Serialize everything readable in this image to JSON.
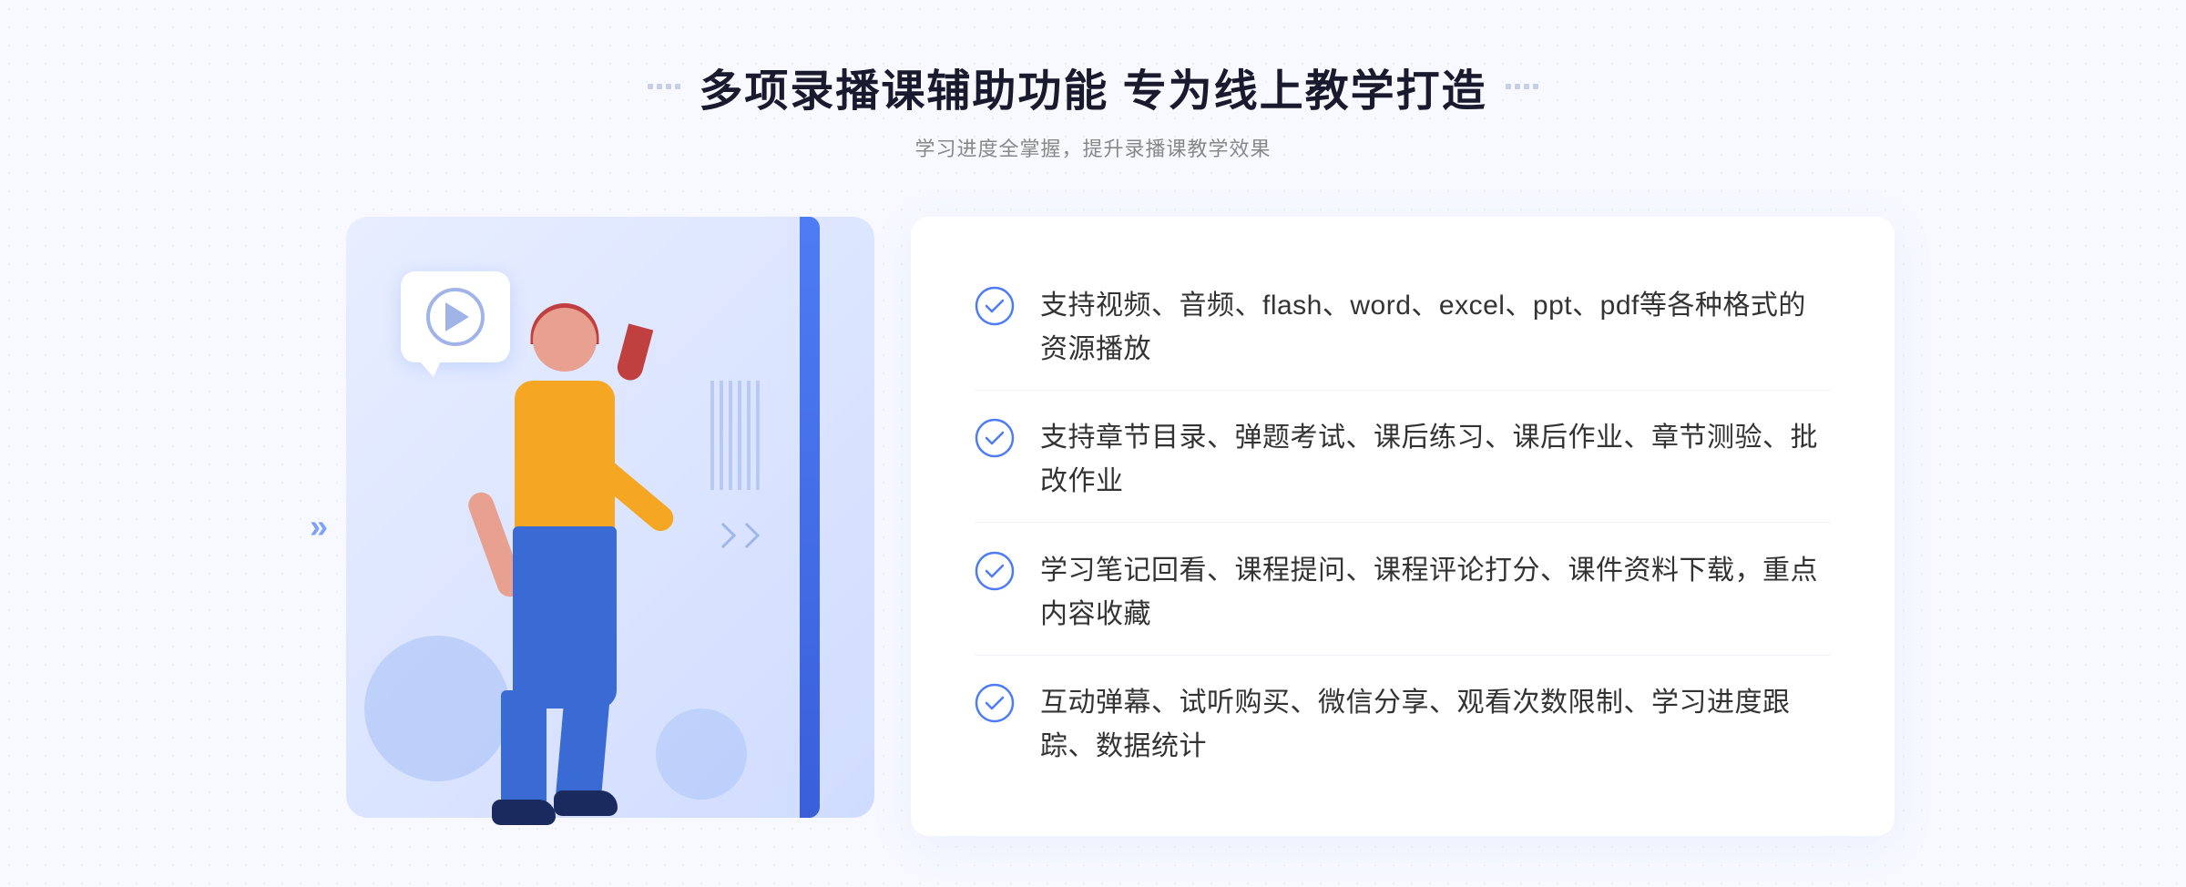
{
  "header": {
    "title": "多项录播课辅助功能 专为线上教学打造",
    "subtitle": "学习进度全掌握，提升录播课教学效果"
  },
  "features": [
    {
      "id": "feature-1",
      "text": "支持视频、音频、flash、word、excel、ppt、pdf等各种格式的资源播放"
    },
    {
      "id": "feature-2",
      "text": "支持章节目录、弹题考试、课后练习、课后作业、章节测验、批改作业"
    },
    {
      "id": "feature-3",
      "text": "学习笔记回看、课程提问、课程评论打分、课件资料下载，重点内容收藏"
    },
    {
      "id": "feature-4",
      "text": "互动弹幕、试听购买、微信分享、观看次数限制、学习进度跟踪、数据统计"
    }
  ],
  "decorations": {
    "arrow_left": "»",
    "play_button": "▶"
  },
  "colors": {
    "primary": "#4d7cf4",
    "accent": "#3a5fd9",
    "text_dark": "#1a1a2e",
    "text_grey": "#888888",
    "check_color": "#4d7cf4"
  }
}
